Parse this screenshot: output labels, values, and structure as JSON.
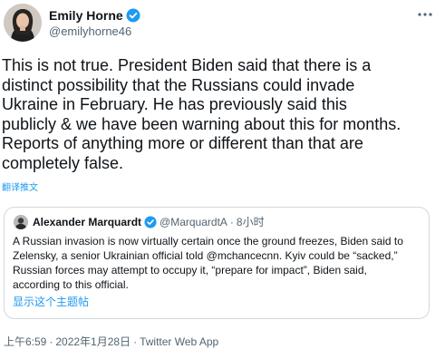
{
  "author": {
    "name": "Emily Horne",
    "handle": "@emilyhorne46"
  },
  "icons": {
    "verified": "verified-badge-icon",
    "more": "more-horizontal-icon"
  },
  "tweet": {
    "text": "This is not true. President Biden said that there is a\ndistinct possibility that the Russians could invade\nUkraine in February. He has previously said this\npublicly & we have been warning about this for months.\nReports of anything more or different than that are\ncompletely false.",
    "translate_label": "翻译推文"
  },
  "quote": {
    "name": "Alexander Marquardt",
    "handle": "@MarquardtA",
    "separator": "·",
    "time": "8小时",
    "text": "A Russian invasion is now virtually certain once the ground freezes, Biden said to\nZelensky, a senior Ukrainian official told @mchancecnn. Kyiv could be “sacked,”\nRussian forces may attempt to occupy it, “prepare for impact”, Biden said,\naccording to this official.",
    "show_thread_label": "显示这个主题帖"
  },
  "meta": {
    "time": "上午6:59",
    "separator": "·",
    "date": "2022年1月28日",
    "source": "Twitter Web App"
  },
  "colors": {
    "accent": "#1d9bf0",
    "text_primary": "#0f1419",
    "text_secondary": "#536471",
    "border": "#cfd9de"
  }
}
